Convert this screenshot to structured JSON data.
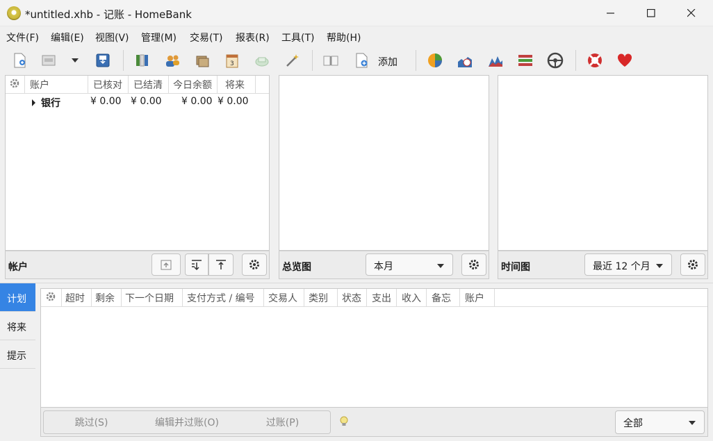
{
  "window": {
    "title": "*untitled.xhb - 记账 - HomeBank"
  },
  "menu": [
    "文件(F)",
    "编辑(E)",
    "视图(V)",
    "管理(M)",
    "交易(T)",
    "报表(R)",
    "工具(T)",
    "帮助(H)"
  ],
  "toolbar": {
    "add_label": "添加"
  },
  "accounts": {
    "columns": [
      "账户",
      "已核对",
      "已结清",
      "今日余额",
      "将来"
    ],
    "rows": [
      {
        "name": "银行",
        "reconciled": "¥ 0.00",
        "cleared": "¥ 0.00",
        "today": "¥ 0.00",
        "future": "¥ 0.00"
      }
    ],
    "footer_label": "帐户"
  },
  "overview": {
    "footer_label": "总览图",
    "period": "本月"
  },
  "timechart": {
    "footer_label": "时间图",
    "period": "最近 12 个月"
  },
  "side_tabs": [
    "计划",
    "将来",
    "提示"
  ],
  "schedule": {
    "columns": [
      "超时",
      "剩余",
      "下一个日期",
      "支付方式 / 编号",
      "交易人",
      "类别",
      "状态",
      "支出",
      "收入",
      "备忘",
      "账户"
    ],
    "buttons": {
      "skip": "跳过(S)",
      "edit_post": "编辑并过账(O)",
      "post": "过账(P)"
    },
    "filter": "全部"
  }
}
